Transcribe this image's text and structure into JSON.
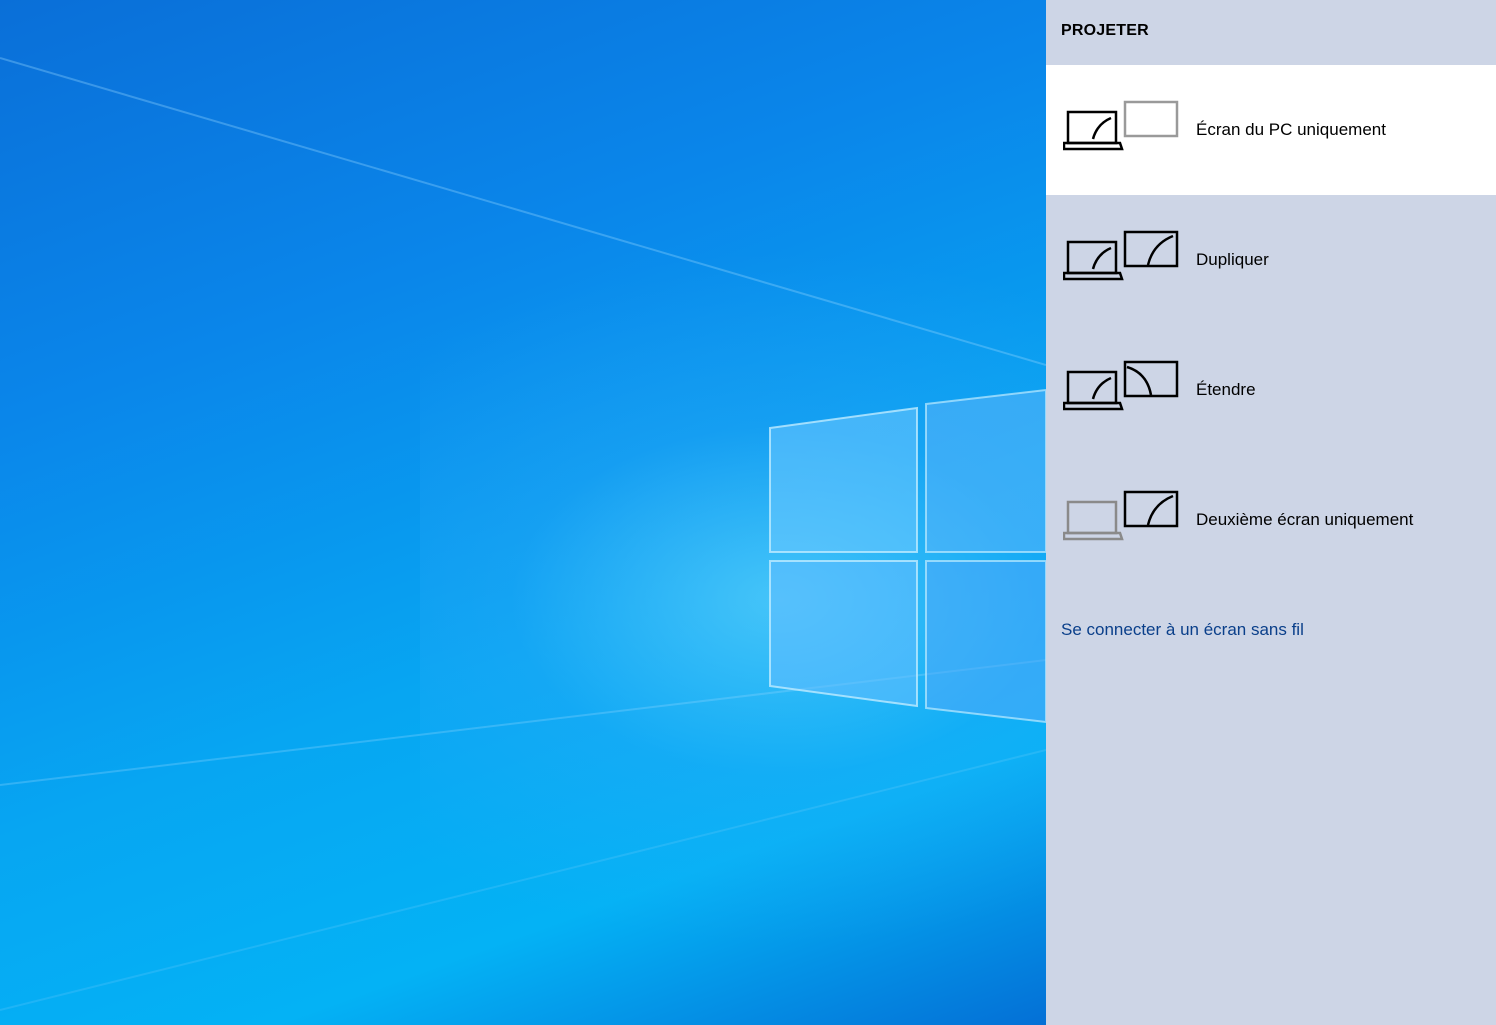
{
  "panel": {
    "title": "PROJETER",
    "options": [
      {
        "label": "Écran du PC uniquement",
        "icon": "pc-screen-only-icon",
        "selected": true
      },
      {
        "label": "Dupliquer",
        "icon": "duplicate-icon",
        "selected": false
      },
      {
        "label": "Étendre",
        "icon": "extend-icon",
        "selected": false
      },
      {
        "label": "Deuxième écran uniquement",
        "icon": "second-screen-only-icon",
        "selected": false
      }
    ],
    "connect_link": "Se connecter à un écran sans fil"
  },
  "colors": {
    "panel_bg": "#cdd5e6",
    "selected_bg": "#ffffff",
    "link": "#0a3f8a",
    "icon_active": "#000000",
    "icon_inactive": "#8a8a8a"
  }
}
